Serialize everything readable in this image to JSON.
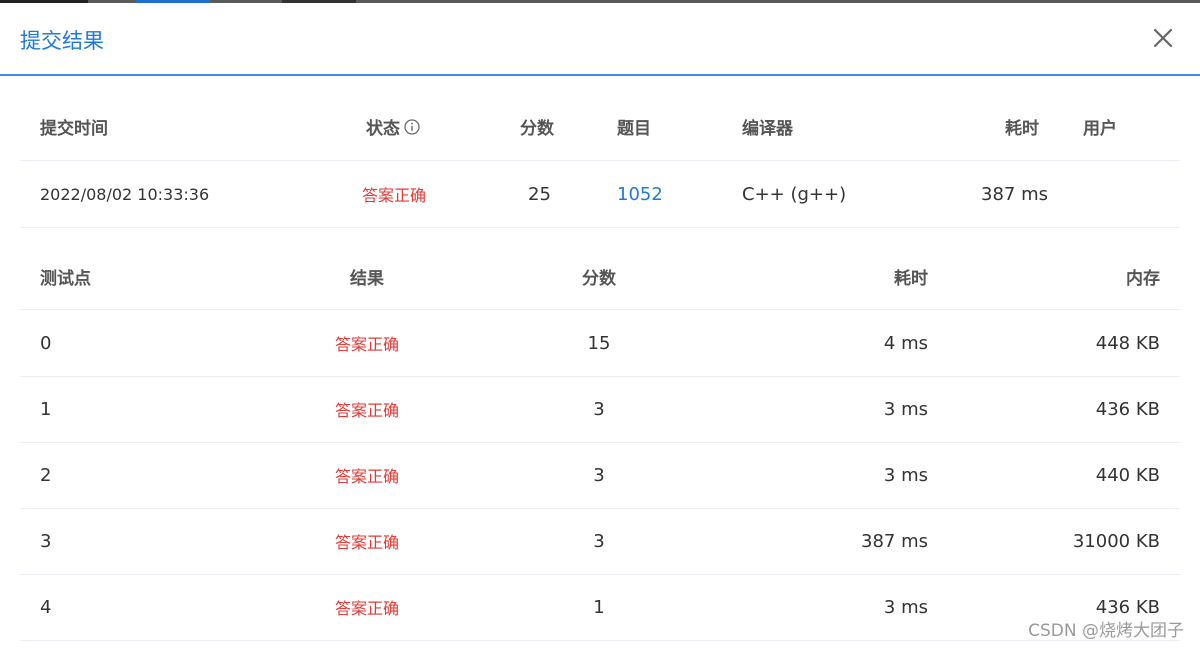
{
  "dialog": {
    "title": "提交结果"
  },
  "submission": {
    "headers": {
      "time": "提交时间",
      "status": "状态",
      "score": "分数",
      "problem": "题目",
      "compiler": "编译器",
      "duration": "耗时",
      "user": "用户"
    },
    "row": {
      "time": "2022/08/02 10:33:36",
      "status": "答案正确",
      "score": "25",
      "problem": "1052",
      "compiler": "C++ (g++)",
      "duration": "387 ms",
      "user": ""
    }
  },
  "tests": {
    "headers": {
      "case": "测试点",
      "result": "结果",
      "score": "分数",
      "duration": "耗时",
      "memory": "内存"
    },
    "rows": [
      {
        "case": "0",
        "result": "答案正确",
        "score": "15",
        "duration": "4 ms",
        "memory": "448 KB"
      },
      {
        "case": "1",
        "result": "答案正确",
        "score": "3",
        "duration": "3 ms",
        "memory": "436 KB"
      },
      {
        "case": "2",
        "result": "答案正确",
        "score": "3",
        "duration": "3 ms",
        "memory": "440 KB"
      },
      {
        "case": "3",
        "result": "答案正确",
        "score": "3",
        "duration": "387 ms",
        "memory": "31000 KB"
      },
      {
        "case": "4",
        "result": "答案正确",
        "score": "1",
        "duration": "3 ms",
        "memory": "436 KB"
      }
    ]
  },
  "watermark": "CSDN @烧烤大团子",
  "colors": {
    "accent": "#1f7ae0",
    "success_text": "#e53935"
  }
}
